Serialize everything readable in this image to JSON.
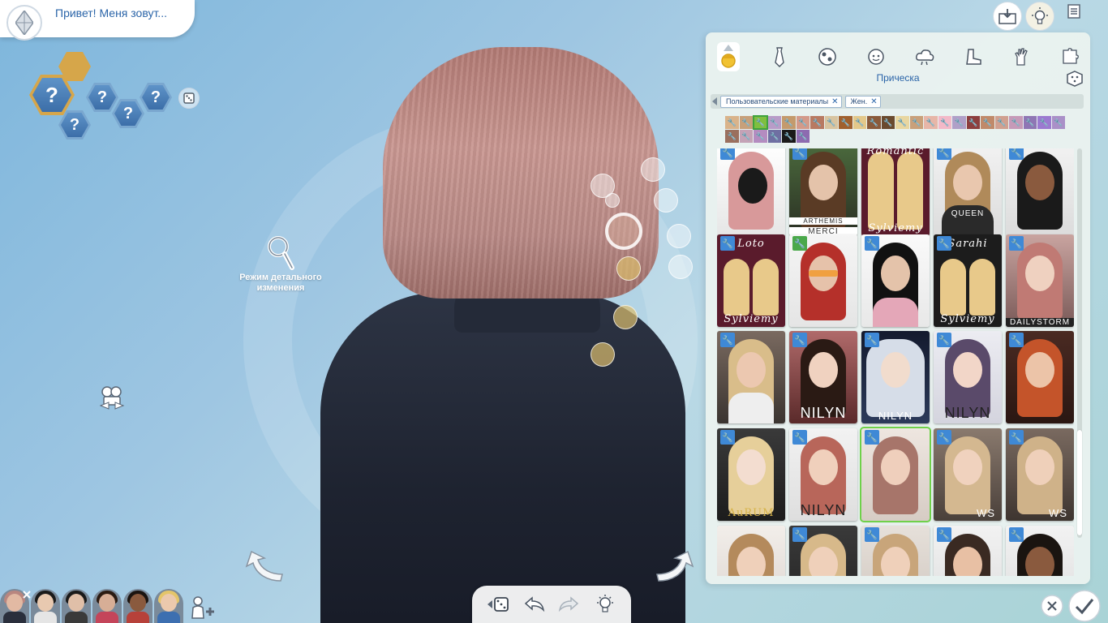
{
  "header": {
    "sim_name": "Привет! Меня зовут..."
  },
  "left": {
    "aspiration_hex_marks": [
      "?",
      "?",
      "?",
      "?",
      "?"
    ],
    "detail_mode_label": "Режим детального изменения"
  },
  "panel": {
    "category_title": "Прическа",
    "filters": [
      {
        "label": "Пользовательские материалы"
      },
      {
        "label": "Жен."
      }
    ],
    "card_labels": {
      "arthemis": "ARTHEMIS",
      "merci": "MERCI",
      "sylviemy": "Sylviemy",
      "loto": "Loto",
      "sarahi": "Sarahi",
      "dailystorm": "DAILYSTORM",
      "nilyn": "NILYN",
      "aurum": "AuRUM",
      "ws": "WS",
      "romantic": "Romantic",
      "queen": "QUEEN"
    }
  },
  "colors": {
    "accent_blue": "#2a64a8",
    "selected_green": "#6fd14a",
    "wrench_blue": "#3f89d6",
    "hair_color": "#c99791"
  },
  "icons": {
    "plumbob": "plumbob-icon",
    "categories": [
      "hair-tab-icon",
      "tie-icon",
      "ball-icon",
      "face-icon",
      "cloud-icon",
      "boot-icon",
      "glove-icon",
      "puzzle-icon"
    ]
  }
}
